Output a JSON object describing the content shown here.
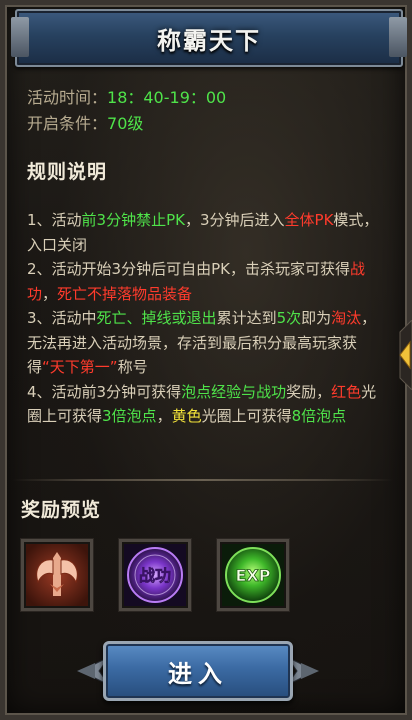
{
  "header": {
    "title": "称霸天下"
  },
  "info": {
    "time_label": "活动时间：",
    "time_value": "18：40-19：00",
    "cond_label": "开启条件：",
    "cond_value": "70级"
  },
  "rules": {
    "title": "规则说明",
    "r1": [
      "1、活动",
      "前3分钟禁止PK",
      "，3分钟后进入",
      "全体PK",
      "模式，入口关闭"
    ],
    "r2": [
      "2、活动开始3分钟后可自由PK，击杀玩家可获得",
      "战功",
      "，",
      "死亡不掉落物品装备"
    ],
    "r3": [
      "3、活动中",
      "死亡、掉线或退出",
      "累计达到",
      "5次",
      "即为",
      "淘汰",
      "，无法再进入活动场景，存活到最后积分最高玩家获得",
      "“天下第一”",
      "称号"
    ],
    "r4": [
      "4、活动前3分钟可获得",
      "泡点经验与战功",
      "奖励，",
      "红色",
      "光圈上可获得",
      "3倍泡点",
      "，",
      "黄色",
      "光圈上可获得",
      "8倍泡点"
    ]
  },
  "rewards": {
    "title": "奖励预览",
    "items": [
      {
        "icon": "axe-emblem-icon"
      },
      {
        "icon": "merit-orb-icon",
        "label": "战功"
      },
      {
        "icon": "exp-orb-icon",
        "label": "EXP"
      }
    ]
  },
  "actions": {
    "enter_label": "进入"
  },
  "colors": {
    "green": "#4fe34a",
    "red": "#ff3b2c",
    "yellow": "#f2e23a",
    "body_text": "#d9cfb8",
    "banner_blue": "#27415f"
  }
}
